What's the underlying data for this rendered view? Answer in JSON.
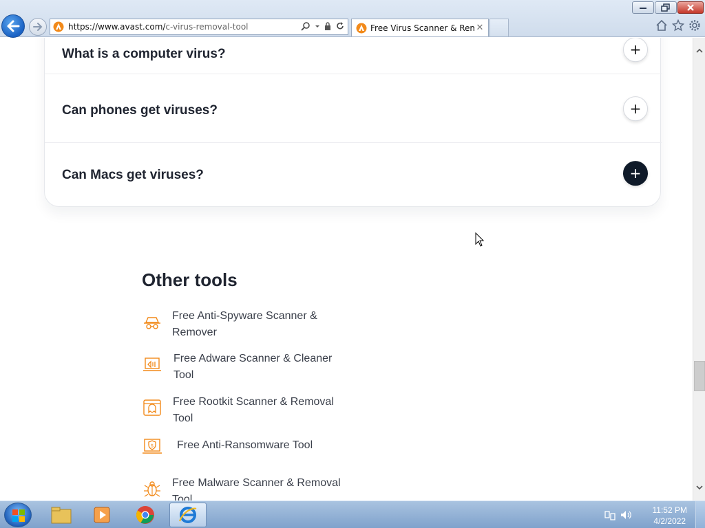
{
  "browser": {
    "address": {
      "host": "https://www.avast.com/",
      "path": "c-virus-removal-tool"
    },
    "tab": {
      "title": "Free Virus Scanner & Remo..."
    }
  },
  "faq": {
    "items": [
      {
        "question": "What is a computer virus?",
        "toggle": "+"
      },
      {
        "question": "Can phones get viruses?",
        "toggle": "+"
      },
      {
        "question": "Can Macs get viruses?",
        "toggle": "+"
      }
    ]
  },
  "other_tools": {
    "title": "Other tools",
    "items": [
      {
        "label": "Free Anti-Spyware Scanner & Remover",
        "icon": "spy-icon"
      },
      {
        "label": "Free Adware Scanner & Cleaner Tool",
        "icon": "adware-laptop-icon"
      },
      {
        "label": "Free Rootkit Scanner & Removal Tool",
        "icon": "rootkit-ghost-icon"
      },
      {
        "label": "Free Anti-Ransomware Tool",
        "icon": "ransomware-shield-icon"
      },
      {
        "label": "Free Malware Scanner & Removal Tool",
        "icon": "malware-bug-icon"
      }
    ]
  },
  "taskbar": {
    "clock": {
      "time": "11:52 PM",
      "date": "4/2/2022"
    }
  },
  "colors": {
    "accent_orange": "#f28a1a",
    "heading": "#1f2430",
    "dark_button": "#0f1a29"
  }
}
